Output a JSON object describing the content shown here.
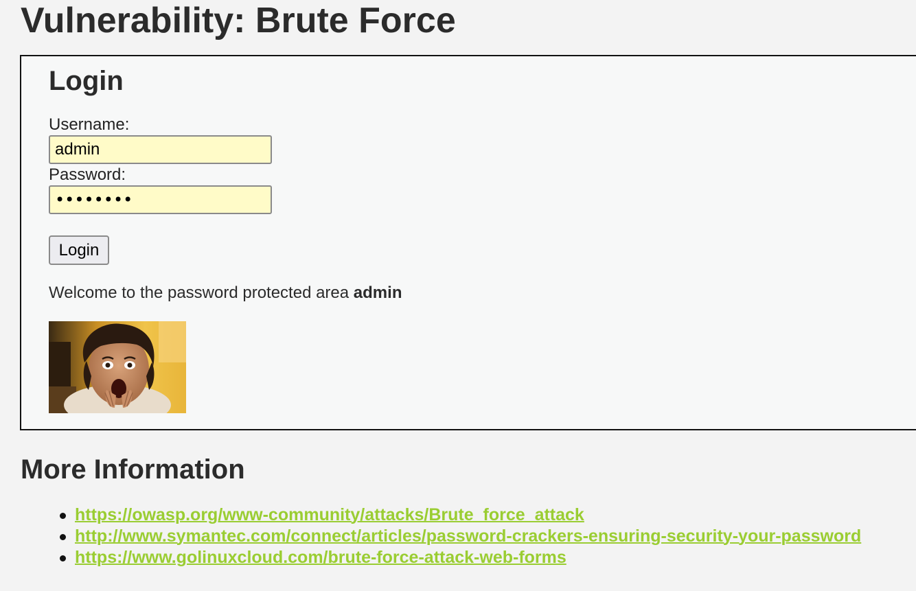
{
  "page": {
    "title": "Vulnerability: Brute Force"
  },
  "login": {
    "heading": "Login",
    "username_label": "Username:",
    "username_value": "admin",
    "password_label": "Password:",
    "password_value": "12345678",
    "button_label": "Login",
    "welcome_text": "Welcome to the password protected area ",
    "welcome_user": "admin"
  },
  "more_info": {
    "heading": "More Information",
    "links": [
      "https://owasp.org/www-community/attacks/Brute_force_attack",
      "http://www.symantec.com/connect/articles/password-crackers-ensuring-security-your-password",
      "https://www.golinuxcloud.com/brute-force-attack-web-forms"
    ]
  },
  "colors": {
    "background": "#f3f3f3",
    "panel_background": "#f7f8f8",
    "input_background": "#fffbc8",
    "link": "#9acd32"
  }
}
